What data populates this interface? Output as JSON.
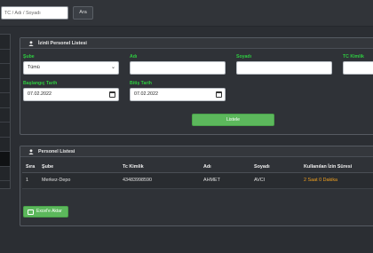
{
  "topbar": {
    "search_placeholder": "TC / Adı / Soyadı",
    "search_button": "Ara"
  },
  "sidebar": {
    "item_count": 10,
    "active_index": 8
  },
  "izinli_panel": {
    "title": "İzinli Personel Listesi",
    "sube_label": "Şube",
    "sube_value": "Tümü",
    "adi_label": "Adı",
    "adi_value": "",
    "soyadi_label": "Soyadı",
    "soyadi_value": "",
    "tc_label": "TC Kimlik",
    "tc_value": "",
    "baslangic_label": "Başlangıç Tarih",
    "baslangic_value": "07.02.2022",
    "bitis_label": "Bitiş Tarih",
    "bitis_value": "07.02.2022",
    "list_button": "Listele"
  },
  "personel_panel": {
    "title": "Personel Listesi",
    "columns": [
      "Sıra",
      "Şube",
      "Tc Kimlik",
      "Adı",
      "Soyadı",
      "Kullanılan İzin Süresi"
    ],
    "rows": [
      {
        "sira": "1",
        "sube": "Merkez-Depo",
        "tc": "43483998590",
        "adi": "AHMET",
        "soyadi": "AVCI",
        "izin": "2 Saat 0 Dakika"
      }
    ],
    "excel_button": "Excel'e Aktar"
  },
  "colors": {
    "accent_green": "#5cb85c",
    "label_green": "#2ecc40",
    "highlight_orange": "#f0a020"
  }
}
